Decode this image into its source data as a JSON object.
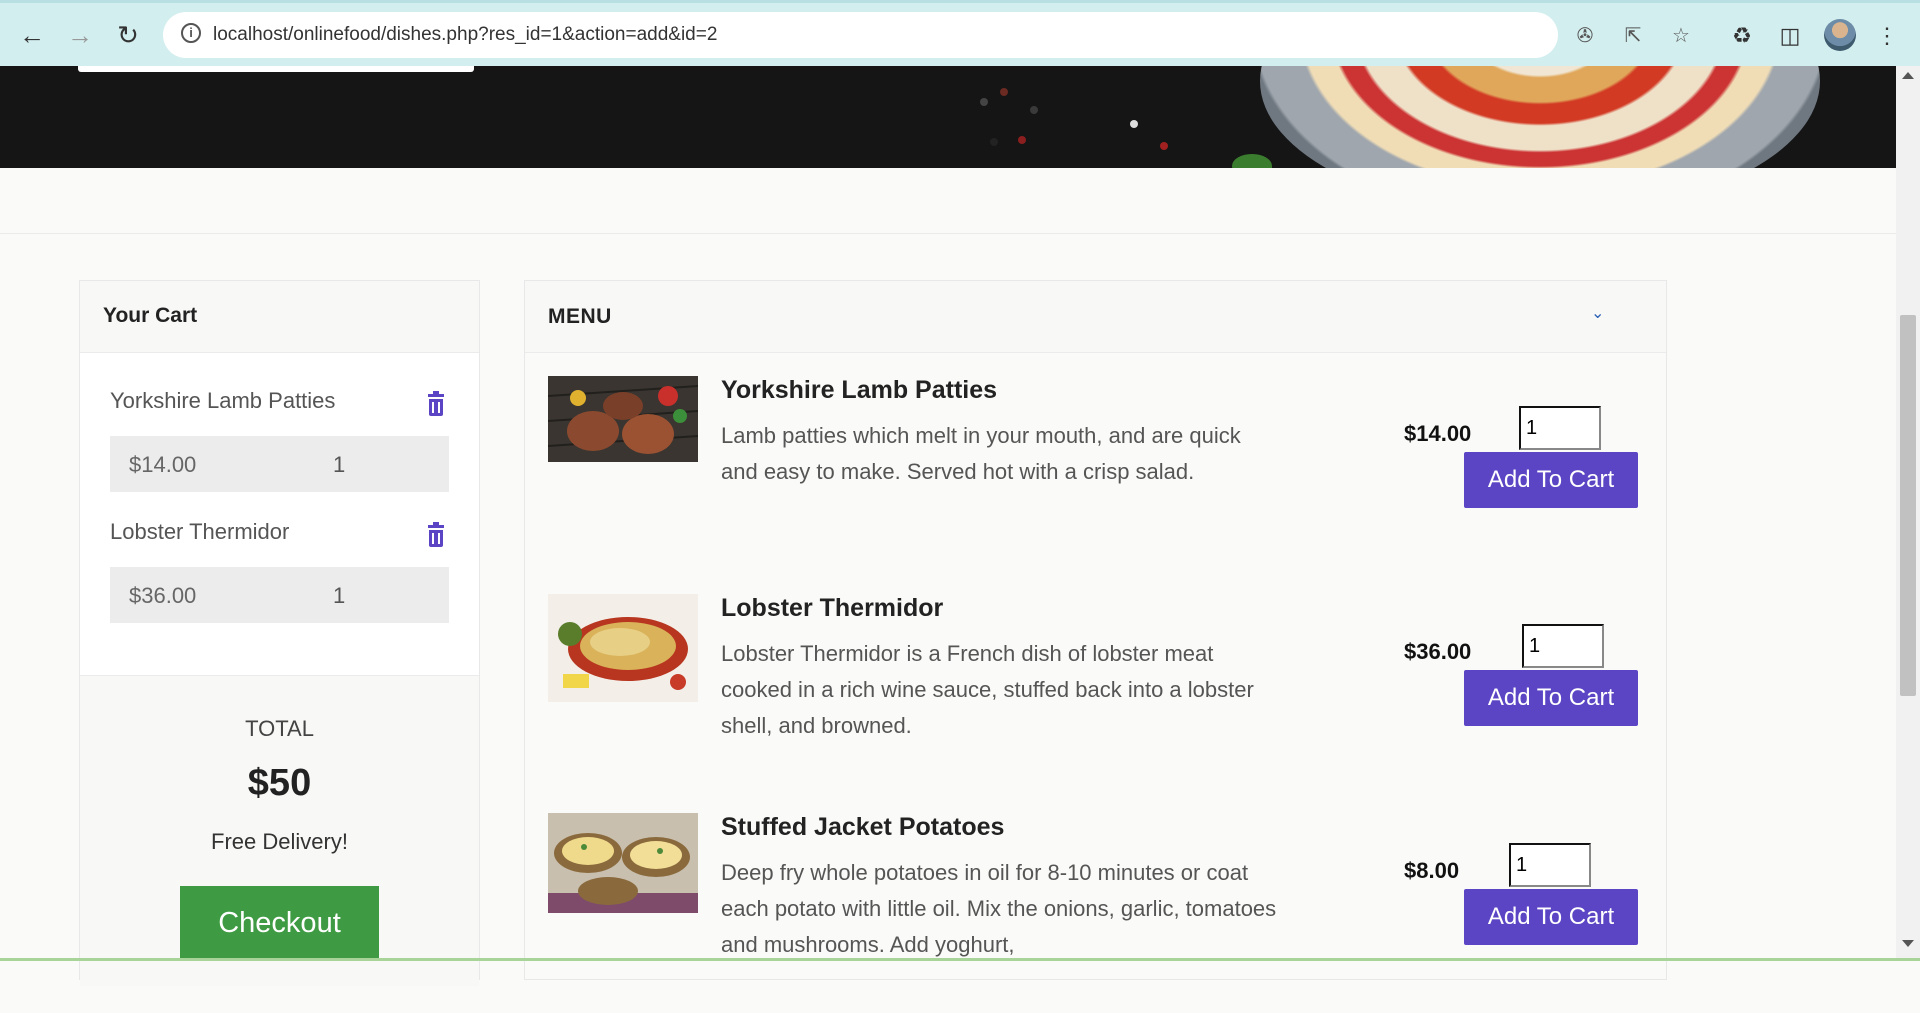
{
  "browser": {
    "url": "localhost/onlinefood/dishes.php?res_id=1&action=add&id=2",
    "icons": [
      "back-icon",
      "forward-icon",
      "reload-icon",
      "site-info-icon",
      "translate-icon",
      "share-icon",
      "bookmark-star-icon",
      "extensions-icon",
      "side-panel-icon",
      "profile-avatar",
      "more-menu-icon"
    ]
  },
  "cart": {
    "title": "Your Cart",
    "items": [
      {
        "name": "Yorkshire Lamb Patties",
        "price": "$14.00",
        "qty": "1"
      },
      {
        "name": "Lobster Thermidor",
        "price": "$36.00",
        "qty": "1"
      }
    ],
    "total_label": "TOTAL",
    "total_value": "$50",
    "delivery": "Free Delivery!",
    "checkout_label": "Checkout"
  },
  "menu": {
    "title": "MENU",
    "dishes": [
      {
        "name": "Yorkshire Lamb Patties",
        "description": "Lamb patties which melt in your mouth, and are quick and easy to make. Served hot with a crisp salad.",
        "price": "$14.00",
        "qty": "1",
        "button": "Add To Cart"
      },
      {
        "name": "Lobster Thermidor",
        "description": "Lobster Thermidor is a French dish of lobster meat cooked in a rich wine sauce, stuffed back into a lobster shell, and browned.",
        "price": "$36.00",
        "qty": "1",
        "button": "Add To Cart"
      },
      {
        "name": "Stuffed Jacket Potatoes",
        "description": "Deep fry whole potatoes in oil for 8-10 minutes or coat each potato with little oil. Mix the onions, garlic, tomatoes and mushrooms. Add yoghurt,",
        "price": "$8.00",
        "qty": "1",
        "button": "Add To Cart"
      }
    ]
  },
  "colors": {
    "accent": "#5b45c4",
    "checkout": "#3f9b43",
    "chrome": "#d3eeef"
  }
}
